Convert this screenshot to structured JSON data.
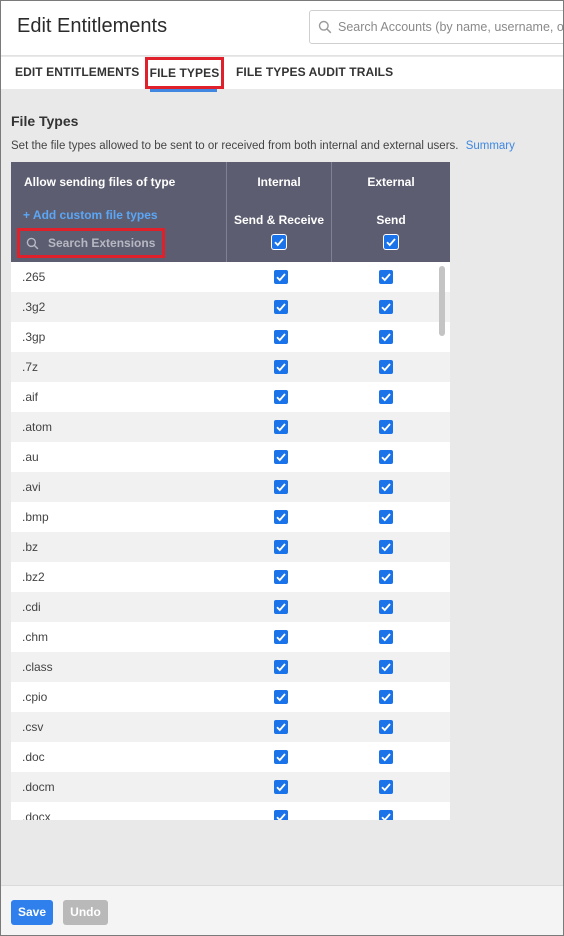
{
  "header": {
    "title": "Edit Entitlements",
    "search_placeholder": "Search Accounts (by name, username, or em"
  },
  "tabs": [
    {
      "label": "EDIT ENTITLEMENTS"
    },
    {
      "label": "FILE TYPES",
      "active": true
    },
    {
      "label": "FILE TYPES AUDIT TRAILS"
    }
  ],
  "section": {
    "title": "File Types",
    "description": "Set the file types allowed to be sent to or received from both internal and external users.",
    "summary_link": "Summary"
  },
  "table": {
    "col1_header": "Allow sending files of type",
    "add_custom_label": "+ Add custom file types",
    "search_placeholder": "Search Extensions",
    "col2_header": "Internal",
    "col2_sub": "Send & Receive",
    "col3_header": "External",
    "col3_sub": "Send",
    "rows": [
      {
        "ext": ".265",
        "internal": true,
        "external": true
      },
      {
        "ext": ".3g2",
        "internal": true,
        "external": true
      },
      {
        "ext": ".3gp",
        "internal": true,
        "external": true
      },
      {
        "ext": ".7z",
        "internal": true,
        "external": true
      },
      {
        "ext": ".aif",
        "internal": true,
        "external": true
      },
      {
        "ext": ".atom",
        "internal": true,
        "external": true
      },
      {
        "ext": ".au",
        "internal": true,
        "external": true
      },
      {
        "ext": ".avi",
        "internal": true,
        "external": true
      },
      {
        "ext": ".bmp",
        "internal": true,
        "external": true
      },
      {
        "ext": ".bz",
        "internal": true,
        "external": true
      },
      {
        "ext": ".bz2",
        "internal": true,
        "external": true
      },
      {
        "ext": ".cdi",
        "internal": true,
        "external": true
      },
      {
        "ext": ".chm",
        "internal": true,
        "external": true
      },
      {
        "ext": ".class",
        "internal": true,
        "external": true
      },
      {
        "ext": ".cpio",
        "internal": true,
        "external": true
      },
      {
        "ext": ".csv",
        "internal": true,
        "external": true
      },
      {
        "ext": ".doc",
        "internal": true,
        "external": true
      },
      {
        "ext": ".docm",
        "internal": true,
        "external": true
      },
      {
        "ext": ".docx",
        "internal": true,
        "external": true
      }
    ]
  },
  "footer": {
    "save_label": "Save",
    "undo_label": "Undo"
  },
  "colors": {
    "accent": "#2f80ed",
    "table_header": "#5c5d70",
    "highlight_box": "#e0202a",
    "checkbox": "#1a73e8"
  }
}
